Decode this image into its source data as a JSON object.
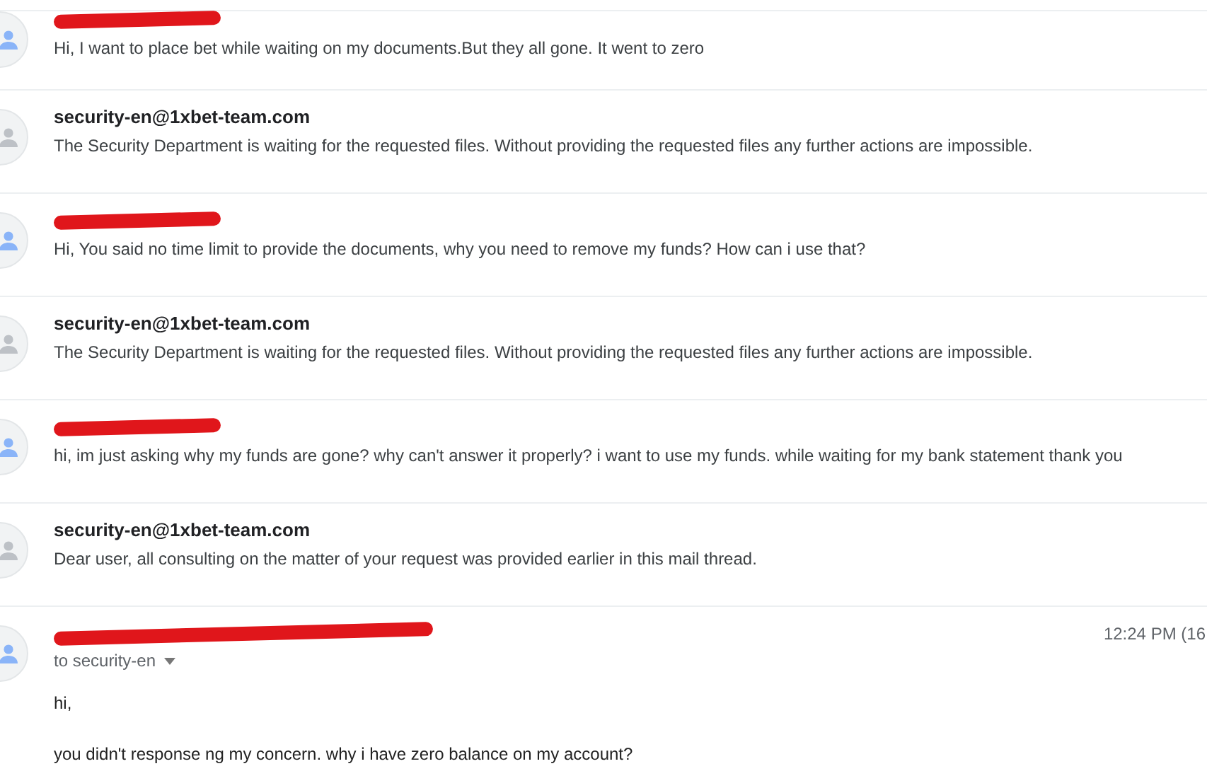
{
  "messages": [
    {
      "kind": "collapsed",
      "redacted": true,
      "user": true,
      "snippet": "Hi, I want to place bet while waiting on my documents.But they all gone. It went to zero"
    },
    {
      "kind": "collapsed",
      "redacted": false,
      "user": false,
      "sender": "security-en@1xbet-team.com",
      "snippet": "The Security Department is waiting for the requested files. Without providing the requested files any further actions are impossible."
    },
    {
      "kind": "collapsed",
      "redacted": true,
      "user": true,
      "snippet": "Hi, You said no time limit to provide the documents, why you need to remove my funds? How can i use that?"
    },
    {
      "kind": "collapsed",
      "redacted": false,
      "user": false,
      "sender": "security-en@1xbet-team.com",
      "snippet": "The Security Department is waiting for the requested files. Without providing the requested files any further actions are impossible."
    },
    {
      "kind": "collapsed",
      "redacted": true,
      "user": true,
      "snippet": "hi, im just asking why my funds are gone? why can't answer it properly? i want to use my funds. while waiting for my bank statement thank you"
    },
    {
      "kind": "collapsed",
      "redacted": false,
      "user": false,
      "sender": "security-en@1xbet-team.com",
      "snippet": "Dear user, all consulting on the matter of your request was provided earlier in this mail thread."
    },
    {
      "kind": "expanded",
      "redacted": true,
      "user": true,
      "time": "12:24 PM (16",
      "recipient": "to security-en",
      "body": [
        "hi,",
        "you didn't response ng my concern. why i have zero balance on my account?"
      ]
    }
  ]
}
